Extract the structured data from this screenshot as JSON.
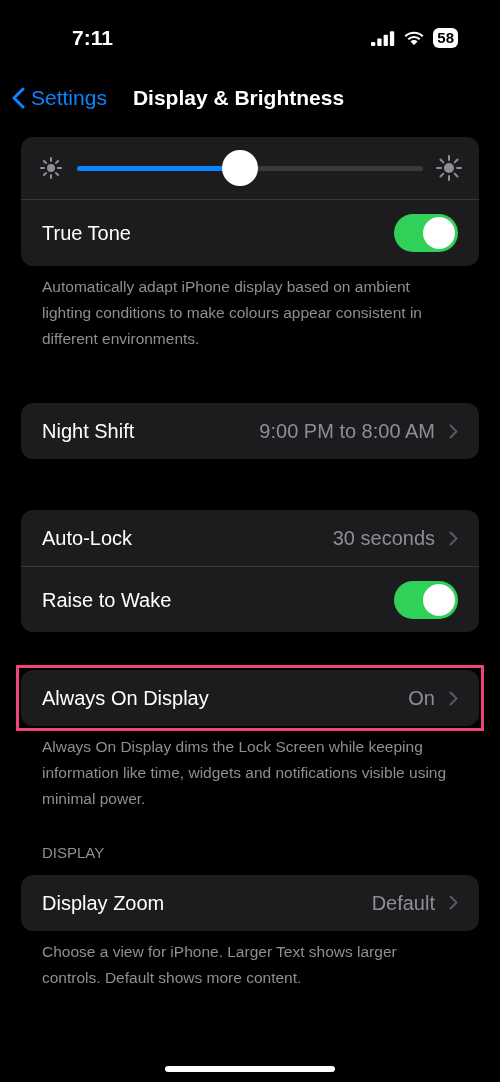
{
  "status_bar": {
    "time": "7:11",
    "battery": "58"
  },
  "nav": {
    "back": "Settings",
    "title": "Display & Brightness"
  },
  "brightness": {
    "level": 0.47
  },
  "groups": [
    {
      "rows": [
        {
          "kind": "toggle",
          "label": "True Tone",
          "on": true
        }
      ],
      "footer": "Automatically adapt iPhone display based on ambient lighting conditions to make colours appear consistent in different environments.",
      "with_slider": true
    },
    {
      "rows": [
        {
          "kind": "link",
          "label": "Night Shift",
          "value": "9:00 PM to 8:00 AM"
        }
      ]
    },
    {
      "rows": [
        {
          "kind": "link",
          "label": "Auto-Lock",
          "value": "30 seconds"
        },
        {
          "kind": "toggle",
          "label": "Raise to Wake",
          "on": true
        }
      ]
    },
    {
      "rows": [
        {
          "kind": "link",
          "label": "Always On Display",
          "value": "On"
        }
      ],
      "highlighted": true,
      "footer": "Always On Display dims the Lock Screen while keeping information like time, widgets and notifications visible using minimal power."
    },
    {
      "header": "DISPLAY",
      "rows": [
        {
          "kind": "link",
          "label": "Display Zoom",
          "value": "Default"
        }
      ],
      "footer": "Choose a view for iPhone. Larger Text shows larger controls. Default shows more content."
    }
  ]
}
